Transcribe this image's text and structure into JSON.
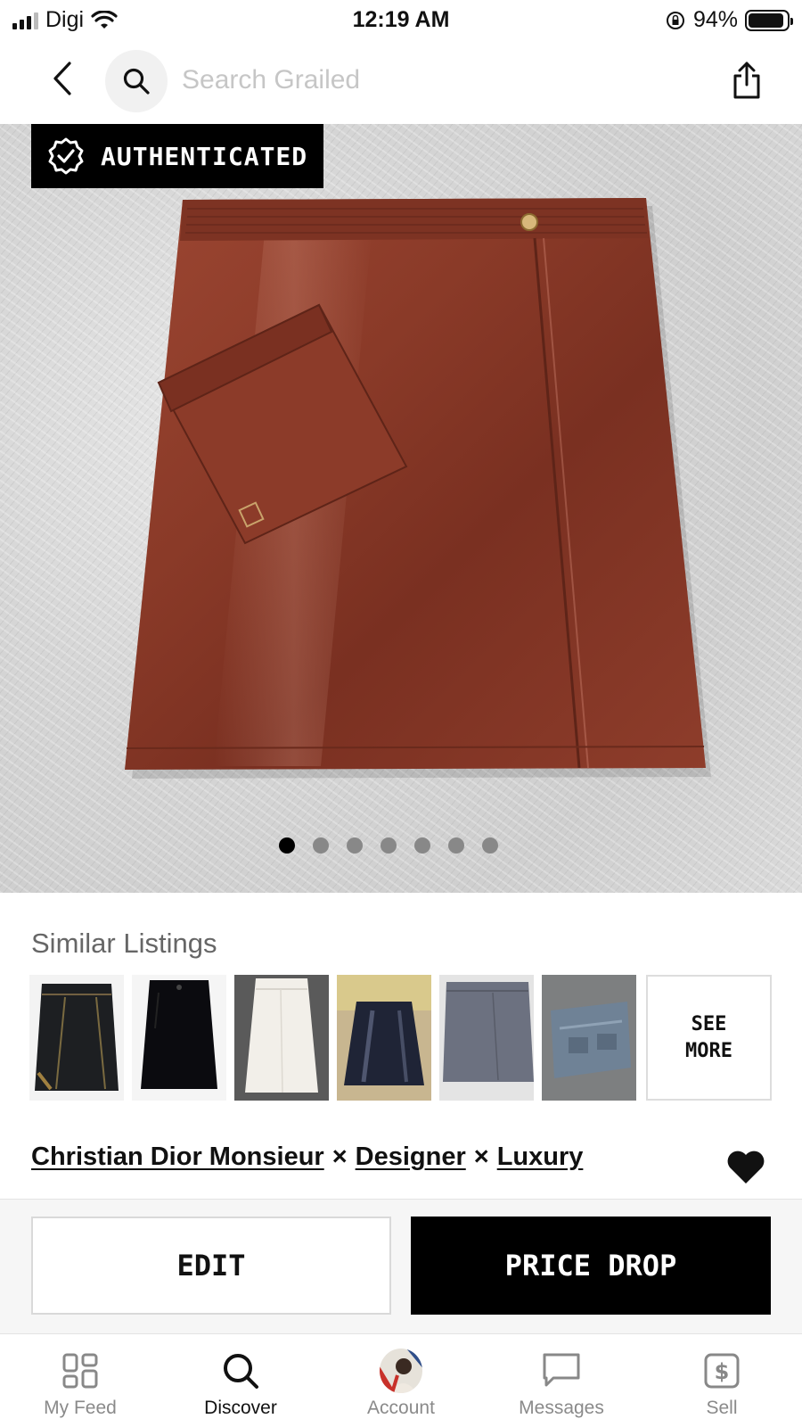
{
  "status_bar": {
    "carrier": "Digi",
    "time": "12:19 AM",
    "battery": "94%",
    "battery_level": 0.94
  },
  "search": {
    "placeholder": "Search Grailed"
  },
  "product": {
    "badge": "AUTHENTICATED",
    "image_count": 7,
    "active_image": 1
  },
  "similar": {
    "title": "Similar Listings",
    "see_more_line1": "SEE",
    "see_more_line2": "MORE"
  },
  "designers": [
    {
      "name": "Christian Dior Monsieur"
    },
    {
      "name": "Designer"
    },
    {
      "name": "Luxury"
    }
  ],
  "designer_separator": "×",
  "actions": {
    "edit": "EDIT",
    "price_drop": "PRICE DROP"
  },
  "tabs": [
    {
      "label": "My Feed",
      "icon": "feed-grid-icon"
    },
    {
      "label": "Discover",
      "icon": "search-icon"
    },
    {
      "label": "Account",
      "icon": "avatar"
    },
    {
      "label": "Messages",
      "icon": "chat-bubble-icon"
    },
    {
      "label": "Sell",
      "icon": "dollar-tag-icon"
    }
  ],
  "colors": {
    "accent": "#000000",
    "skirt": "#8a3a28"
  }
}
